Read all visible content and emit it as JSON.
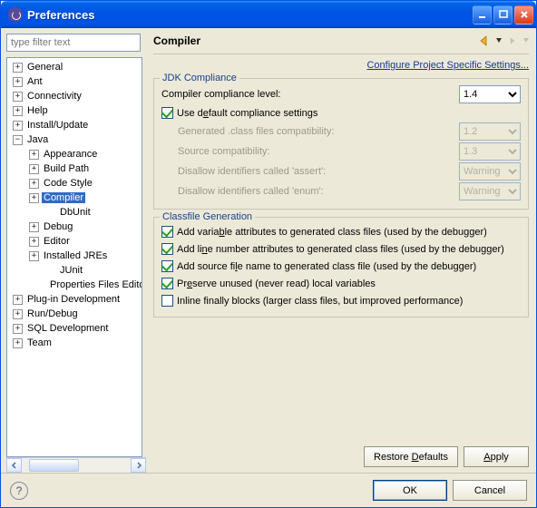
{
  "window": {
    "title": "Preferences"
  },
  "filter": {
    "placeholder": "type filter text"
  },
  "tree": [
    {
      "label": "General",
      "exp": "+",
      "ind": 1
    },
    {
      "label": "Ant",
      "exp": "+",
      "ind": 1
    },
    {
      "label": "Connectivity",
      "exp": "+",
      "ind": 1
    },
    {
      "label": "Help",
      "exp": "+",
      "ind": 1
    },
    {
      "label": "Install/Update",
      "exp": "+",
      "ind": 1
    },
    {
      "label": "Java",
      "exp": "-",
      "ind": 1
    },
    {
      "label": "Appearance",
      "exp": "+",
      "ind": 2
    },
    {
      "label": "Build Path",
      "exp": "+",
      "ind": 2
    },
    {
      "label": "Code Style",
      "exp": "+",
      "ind": 2
    },
    {
      "label": "Compiler",
      "exp": "+",
      "ind": 2,
      "sel": true
    },
    {
      "label": "DbUnit",
      "exp": "",
      "ind": 3
    },
    {
      "label": "Debug",
      "exp": "+",
      "ind": 2
    },
    {
      "label": "Editor",
      "exp": "+",
      "ind": 2
    },
    {
      "label": "Installed JREs",
      "exp": "+",
      "ind": 2
    },
    {
      "label": "JUnit",
      "exp": "",
      "ind": 3
    },
    {
      "label": "Properties Files Editor",
      "exp": "",
      "ind": 3
    },
    {
      "label": "Plug-in Development",
      "exp": "+",
      "ind": 1
    },
    {
      "label": "Run/Debug",
      "exp": "+",
      "ind": 1
    },
    {
      "label": "SQL Development",
      "exp": "+",
      "ind": 1
    },
    {
      "label": "Team",
      "exp": "+",
      "ind": 1
    }
  ],
  "page": {
    "title": "Compiler",
    "configure_link": "Configure Project Specific Settings...",
    "jdk_group": "JDK Compliance",
    "compliance_label": "Compiler compliance level:",
    "compliance_value": "1.4",
    "use_default": "Use default compliance settings",
    "gen_class": "Generated .class files compatibility:",
    "gen_class_val": "1.2",
    "src_compat": "Source compatibility:",
    "src_compat_val": "1.3",
    "dis_assert": "Disallow identifiers called 'assert':",
    "dis_assert_val": "Warning",
    "dis_enum": "Disallow identifiers called 'enum':",
    "dis_enum_val": "Warning",
    "class_group": "Classfile Generation",
    "add_var": "Add variable attributes to generated class files (used by the debugger)",
    "add_line": "Add line number attributes to generated class files (used by the debugger)",
    "add_src": "Add source file name to generated class file (used by the debugger)",
    "preserve": "Preserve unused (never read) local variables",
    "inline": "Inline finally blocks (larger class files, but improved performance)",
    "restore": "Restore Defaults",
    "apply": "Apply",
    "ok": "OK",
    "cancel": "Cancel"
  }
}
